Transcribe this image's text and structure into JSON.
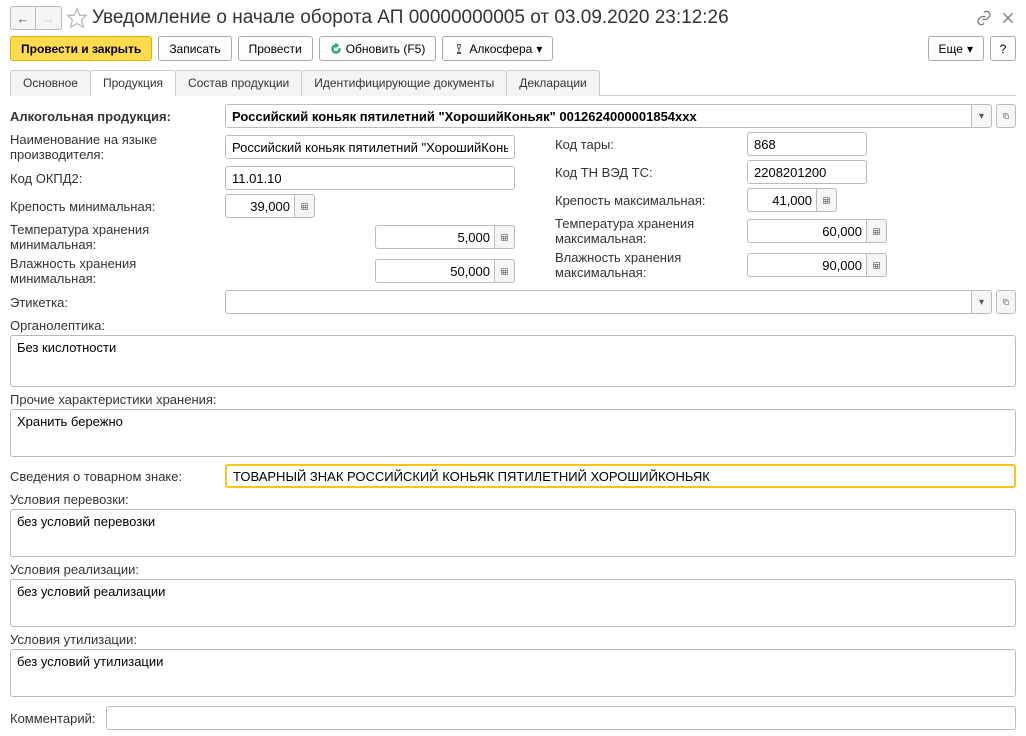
{
  "title": "Уведомление о начале оборота АП 00000000005 от 03.09.2020 23:12:26",
  "toolbar": {
    "post_close": "Провести и закрыть",
    "save": "Записать",
    "post": "Провести",
    "refresh": "Обновить (F5)",
    "alko": "Алкосфера",
    "more": "Еще",
    "help": "?"
  },
  "tabs": {
    "main": "Основное",
    "product": "Продукция",
    "composition": "Состав продукции",
    "ident": "Идентифицирующие документы",
    "decl": "Декларации"
  },
  "labels": {
    "alco_product": "Алкогольная продукция:",
    "name_producer": "Наименование на языке производителя:",
    "okpd": "Код ОКПД2:",
    "strength_min": "Крепость минимальная:",
    "temp_min": "Температура хранения минимальная:",
    "humidity_min": "Влажность хранения минимальная:",
    "label": "Этикетка:",
    "organoleptic": "Органолептика:",
    "other_storage": "Прочие характеристики хранения:",
    "trademark": "Сведения о товарном знаке:",
    "transport": "Условия перевозки:",
    "realization": "Условия реализации:",
    "utilization": "Условия утилизации:",
    "comment": "Комментарий:",
    "tare_code": "Код тары:",
    "tnved": "Код ТН ВЭД ТС:",
    "strength_max": "Крепость максимальная:",
    "temp_max": "Температура хранения максимальная:",
    "humidity_max": "Влажность хранения максимальная:"
  },
  "values": {
    "alco_product": "Российский коньяк пятилетний \"ХорошийКоньяк\" 0012624000001854xxx",
    "name_producer": "Российский коньяк пятилетний \"ХорошийКоньяк\"",
    "okpd": "11.01.10",
    "strength_min": "39,000",
    "temp_min": "5,000",
    "humidity_min": "50,000",
    "label": "",
    "organoleptic": "Без кислотности",
    "other_storage": "Хранить бережно",
    "trademark": "ТОВАРНЫЙ ЗНАК РОССИЙСКИЙ КОНЬЯК ПЯТИЛЕТНИЙ ХОРОШИЙКОНЬЯК",
    "transport": "без условий перевозки",
    "realization": "без условий реализации",
    "utilization": "без условий утилизации",
    "comment": "",
    "tare_code": "868",
    "tnved": "2208201200",
    "strength_max": "41,000",
    "temp_max": "60,000",
    "humidity_max": "90,000"
  }
}
